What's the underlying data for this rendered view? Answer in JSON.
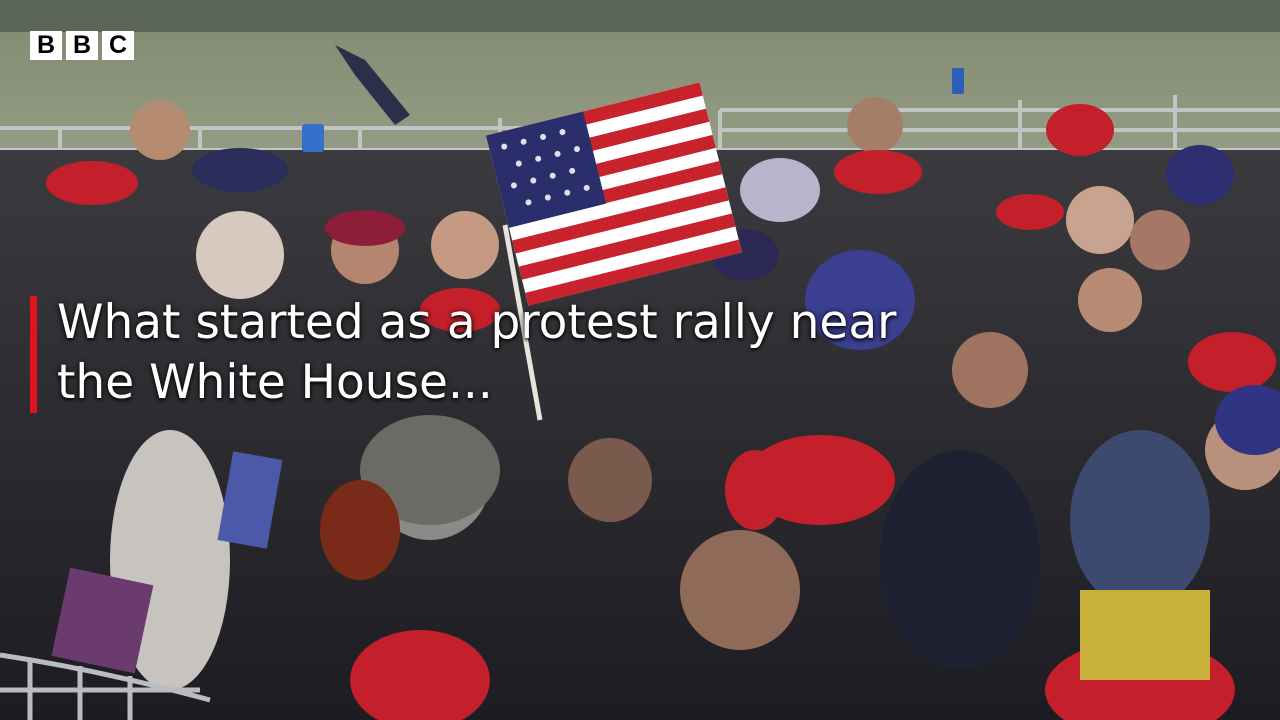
{
  "logo": {
    "letters": [
      "B",
      "B",
      "C"
    ]
  },
  "caption": {
    "line1": "What started as a protest rally near",
    "line2": "the White House..."
  },
  "colors": {
    "caption_bar": "#e0141e",
    "logo_bg": "#ffffff",
    "caption_text": "#ffffff"
  }
}
